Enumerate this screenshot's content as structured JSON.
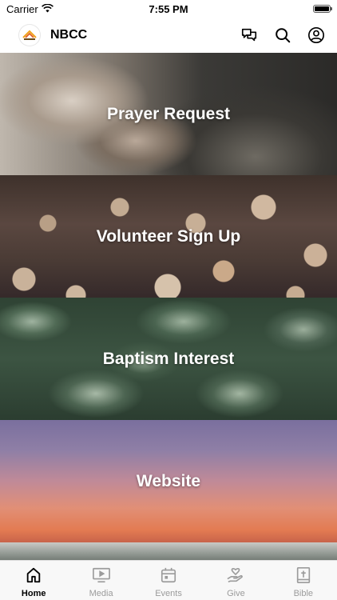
{
  "status_bar": {
    "carrier": "Carrier",
    "time": "7:55 PM"
  },
  "header": {
    "title": "NBCC"
  },
  "tiles": [
    {
      "label": "Prayer Request"
    },
    {
      "label": "Volunteer Sign Up"
    },
    {
      "label": "Baptism Interest"
    },
    {
      "label": "Website"
    }
  ],
  "tabs": [
    {
      "label": "Home",
      "icon": "home-icon",
      "active": true
    },
    {
      "label": "Media",
      "icon": "media-icon",
      "active": false
    },
    {
      "label": "Events",
      "icon": "calendar-icon",
      "active": false
    },
    {
      "label": "Give",
      "icon": "give-icon",
      "active": false
    },
    {
      "label": "Bible",
      "icon": "bible-icon",
      "active": false
    }
  ]
}
